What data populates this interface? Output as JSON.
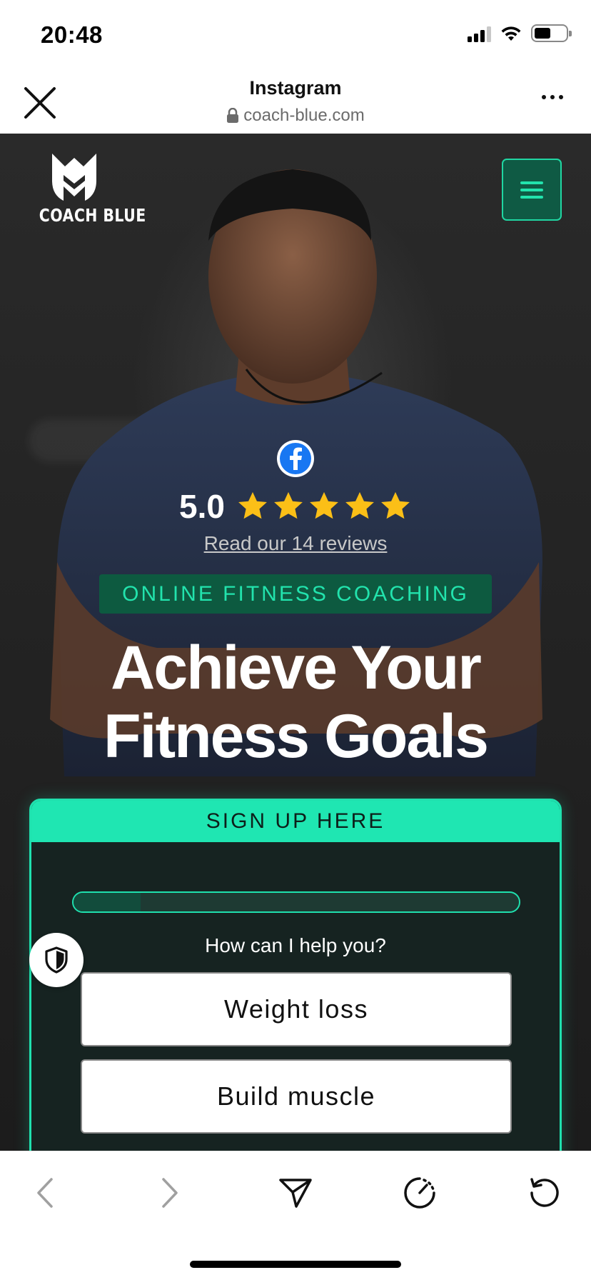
{
  "status_bar": {
    "time": "20:48",
    "icons": [
      "cellular-signal-icon",
      "wifi-icon",
      "battery-icon"
    ]
  },
  "browser": {
    "title": "Instagram",
    "url": "coach-blue.com",
    "close_icon": "close-icon",
    "more_icon": "more-icon"
  },
  "site": {
    "logo_text": "COACH BLUE",
    "menu_icon": "hamburger-menu-icon",
    "rating": {
      "source_icon": "facebook-icon",
      "score": "5.0",
      "stars": 5,
      "reviews_link": "Read our 14 reviews"
    },
    "tagline": "ONLINE FITNESS COACHING",
    "headline_line1": "Achieve Your",
    "headline_line2": "Fitness Goals",
    "signup": {
      "header": "SIGN UP HERE",
      "progress": 0.15,
      "question": "How can I help you?",
      "options": [
        "Weight loss",
        "Build muscle"
      ]
    },
    "privacy_icon": "shield-icon"
  },
  "toolbar": {
    "items": [
      "back-icon",
      "forward-icon",
      "share-icon",
      "speed-icon",
      "reload-icon"
    ]
  },
  "colors": {
    "accent": "#1fe6b2",
    "accent_dark": "#0d5a40",
    "star": "#fbbf17",
    "facebook": "#1877f2"
  }
}
